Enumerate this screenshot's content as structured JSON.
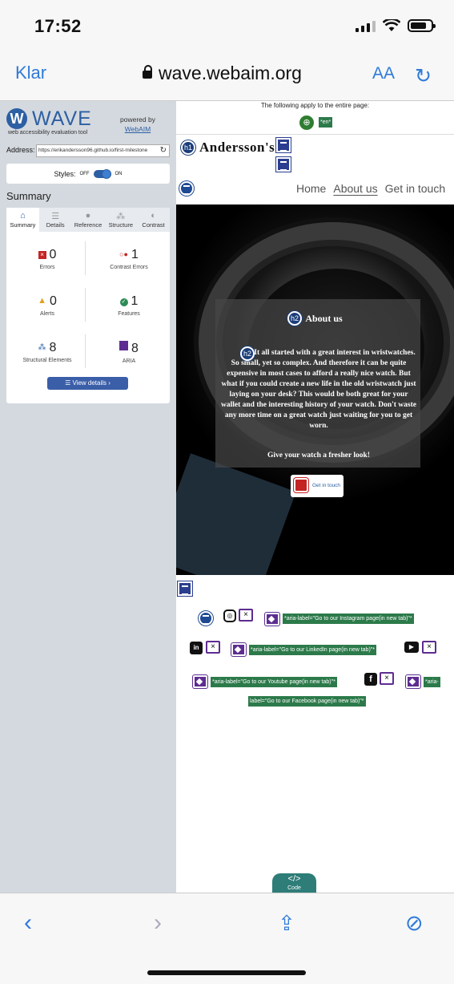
{
  "status": {
    "time": "17:52"
  },
  "browser": {
    "done_label": "Klar",
    "url": "wave.webaim.org",
    "text_size_label": "AA",
    "reload_icon": "reload-icon"
  },
  "wave": {
    "logo_letter": "W",
    "name": "WAVE",
    "subtitle": "web accessibility evaluation tool",
    "powered_by": "powered by",
    "powered_link": "WebAIM",
    "address_label": "Address:",
    "address_value": "https://erikandersson96.github.io/first-milestone",
    "styles_label": "Styles:",
    "styles_off": "OFF",
    "styles_on": "ON",
    "summary_title": "Summary",
    "tabs": [
      {
        "label": "Summary",
        "icon": "home-icon"
      },
      {
        "label": "Details",
        "icon": "list-icon"
      },
      {
        "label": "Reference",
        "icon": "info-icon"
      },
      {
        "label": "Structure",
        "icon": "structure-icon"
      },
      {
        "label": "Contrast",
        "icon": "contrast-icon"
      }
    ],
    "stats": [
      {
        "value": "0",
        "label": "Errors"
      },
      {
        "value": "1",
        "label": "Contrast Errors"
      },
      {
        "value": "0",
        "label": "Alerts"
      },
      {
        "value": "1",
        "label": "Features"
      },
      {
        "value": "8",
        "label": "Structural Elements"
      },
      {
        "value": "8",
        "label": "ARIA"
      }
    ],
    "view_details": "View details ›"
  },
  "page": {
    "applies_text": "The following apply to the entire page:",
    "lang_tag": "*en*",
    "brand": "Andersson's",
    "nav": [
      "Home",
      "About us",
      "Get in touch"
    ],
    "h1_badge": "h1",
    "h2_badge": "h2",
    "about_title": "About us",
    "about_text": "It all started with a great interest in wristwatches. So small, yet so complex. And therefore it can be quite expensive in most cases to afford a really nice watch. But what if you could create a new life in the old wristwatch just laying on your desk? This would be both great for your wallet and the interesting history of your watch. Don't waste any more time on a great watch just waiting for you to get worn.",
    "about_text2": "Give your watch a fresher look!",
    "git_button": "Get in touch",
    "aria_labels": [
      "*aria-label=\"Go to our Instagram page(in new tab)\"*",
      "*aria-label=\"Go to our LinkedIn page(in new tab)\"*",
      "*aria-label=\"Go to our Youtube page(in new tab)\"*",
      "*aria-",
      "label=\"Go to our Facebook page(in new tab)\"*"
    ],
    "code_label": "Code"
  }
}
